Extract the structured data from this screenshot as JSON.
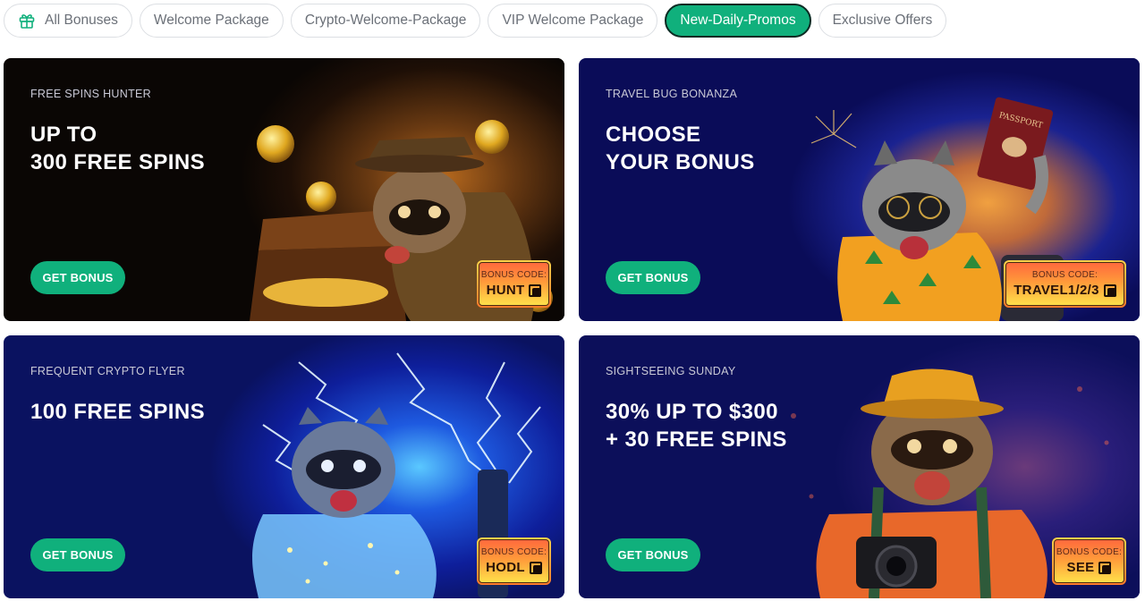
{
  "tabs": [
    {
      "label": "All Bonuses",
      "icon": "gift-icon"
    },
    {
      "label": "Welcome Package"
    },
    {
      "label": "Crypto-Welcome-Package"
    },
    {
      "label": "VIP Welcome Package"
    },
    {
      "label": "New-Daily-Promos",
      "active": true
    },
    {
      "label": "Exclusive Offers"
    }
  ],
  "cards": [
    {
      "kicker": "FREE SPINS HUNTER",
      "title_lines": [
        "UP TO",
        "300 FREE SPINS"
      ],
      "button": "GET BONUS",
      "code_label": "BONUS CODE:",
      "code": "HUNT"
    },
    {
      "kicker": "TRAVEL BUG BONANZA",
      "title_lines": [
        "CHOOSE",
        "YOUR BONUS"
      ],
      "button": "GET BONUS",
      "code_label": "BONUS CODE:",
      "code": "TRAVEL1/2/3",
      "passport_text": "PASSPORT"
    },
    {
      "kicker": "FREQUENT CRYPTO FLYER",
      "title_lines": [
        "100 FREE SPINS"
      ],
      "button": "GET BONUS",
      "code_label": "BONUS CODE:",
      "code": "HODL"
    },
    {
      "kicker": "SIGHTSEEING SUNDAY",
      "title_lines": [
        "30% UP TO $300",
        "+ 30 FREE SPINS"
      ],
      "button": "GET BONUS",
      "code_label": "BONUS CODE:",
      "code": "SEE"
    }
  ],
  "colors": {
    "accent": "#10b07c",
    "card1_bg": "#0d0806",
    "card2_bg": "#0b0d5a",
    "card3_bg": "#0a1260",
    "card4_bg": "#0c0f5a"
  }
}
